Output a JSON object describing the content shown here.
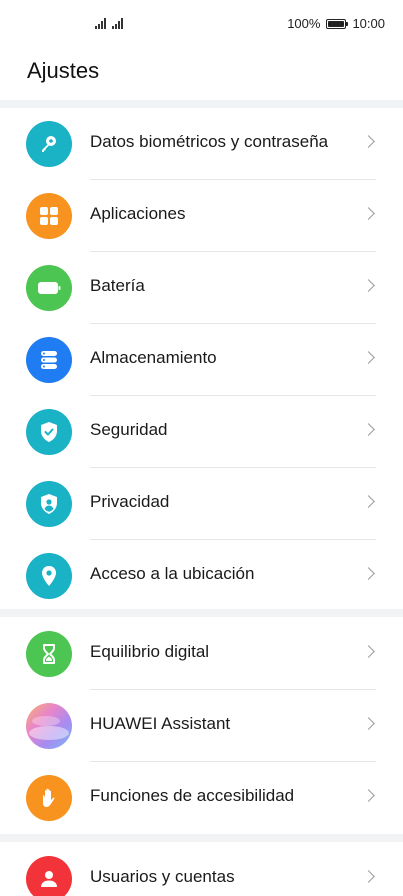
{
  "status_bar": {
    "battery_percent": "100%",
    "time": "10:00",
    "battery_level": 1.0
  },
  "page": {
    "title": "Ajustes"
  },
  "groups": [
    {
      "items": [
        {
          "label": "Datos biométricos y contraseña",
          "icon": "key-icon",
          "color": "#1ab3c6"
        },
        {
          "label": "Aplicaciones",
          "icon": "apps-grid-icon",
          "color": "#f7931e"
        },
        {
          "label": "Batería",
          "icon": "battery-icon",
          "color": "#4cc552"
        },
        {
          "label": "Almacenamiento",
          "icon": "storage-icon",
          "color": "#1f7cf2"
        },
        {
          "label": "Seguridad",
          "icon": "shield-check-icon",
          "color": "#1ab3c6"
        },
        {
          "label": "Privacidad",
          "icon": "privacy-shield-icon",
          "color": "#1ab3c6"
        },
        {
          "label": "Acceso a la ubicación",
          "icon": "location-pin-icon",
          "color": "#1ab3c6"
        }
      ]
    },
    {
      "items": [
        {
          "label": "Equilibrio digital",
          "icon": "hourglass-icon",
          "color": "#4cc552"
        },
        {
          "label": "HUAWEI Assistant",
          "icon": "huawei-assistant-icon",
          "color": "#e985c9"
        },
        {
          "label": "Funciones de accesibilidad",
          "icon": "hand-icon",
          "color": "#f7931e"
        }
      ]
    },
    {
      "items": [
        {
          "label": "Usuarios y cuentas",
          "icon": "user-icon",
          "color": "#f2333a"
        }
      ]
    }
  ]
}
